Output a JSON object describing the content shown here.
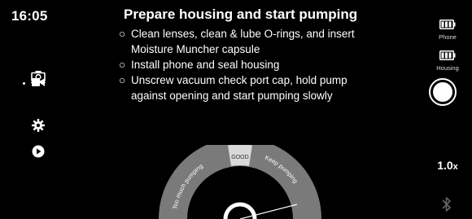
{
  "status": {
    "time": "16:05"
  },
  "instructions": {
    "title": "Prepare housing and start pumping",
    "bullet": "○",
    "steps": [
      {
        "line1": "Clean lenses, clean & lube O-rings, and insert",
        "line2": "Moisture Muncher capsule"
      },
      {
        "line1": "Install phone and seal housing",
        "line2": ""
      },
      {
        "line1": "Unscrew vacuum check port cap, hold pump",
        "line2": "against opening and start pumping slowly"
      }
    ]
  },
  "left_toolbar": {
    "items": [
      {
        "icon": "camera-icon",
        "active": false
      },
      {
        "icon": "video-camera-icon",
        "active": true
      },
      {
        "icon": "gear-icon",
        "active": false
      },
      {
        "icon": "play-icon",
        "active": false
      }
    ]
  },
  "gauge": {
    "left_label": "Too much pumping",
    "center_label": "GOOD",
    "right_label": "Keep pumping",
    "colors": {
      "outer": "#7a7a7a",
      "good": "#d9d9d9",
      "needle": "#ffffff"
    }
  },
  "right_panel": {
    "phone_battery_label": "Phone",
    "housing_battery_label": "Housing",
    "zoom_value": "1.0",
    "zoom_unit": "x",
    "bluetooth_icon": "bluetooth-icon"
  }
}
